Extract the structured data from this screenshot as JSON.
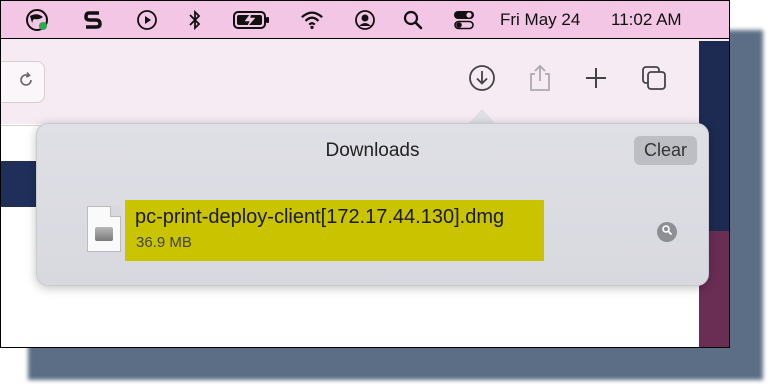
{
  "menubar": {
    "date": "Fri May 24",
    "time": "11:02 AM",
    "icons": [
      "globe-vpn-icon",
      "s-app-icon",
      "play-circle-icon",
      "bluetooth-icon",
      "battery-charging-icon",
      "wifi-icon",
      "user-circle-icon",
      "search-icon",
      "control-center-icon"
    ]
  },
  "toolbar": {
    "icons": [
      "reload-icon",
      "downloads-icon",
      "share-icon",
      "new-tab-icon",
      "tab-overview-icon"
    ]
  },
  "downloads": {
    "title": "Downloads",
    "clear_label": "Clear",
    "items": [
      {
        "file_name": "pc-print-deploy-client[172.17.44.130].dmg",
        "size": "36.9 MB",
        "highlight_color": "#c9c300"
      }
    ]
  }
}
